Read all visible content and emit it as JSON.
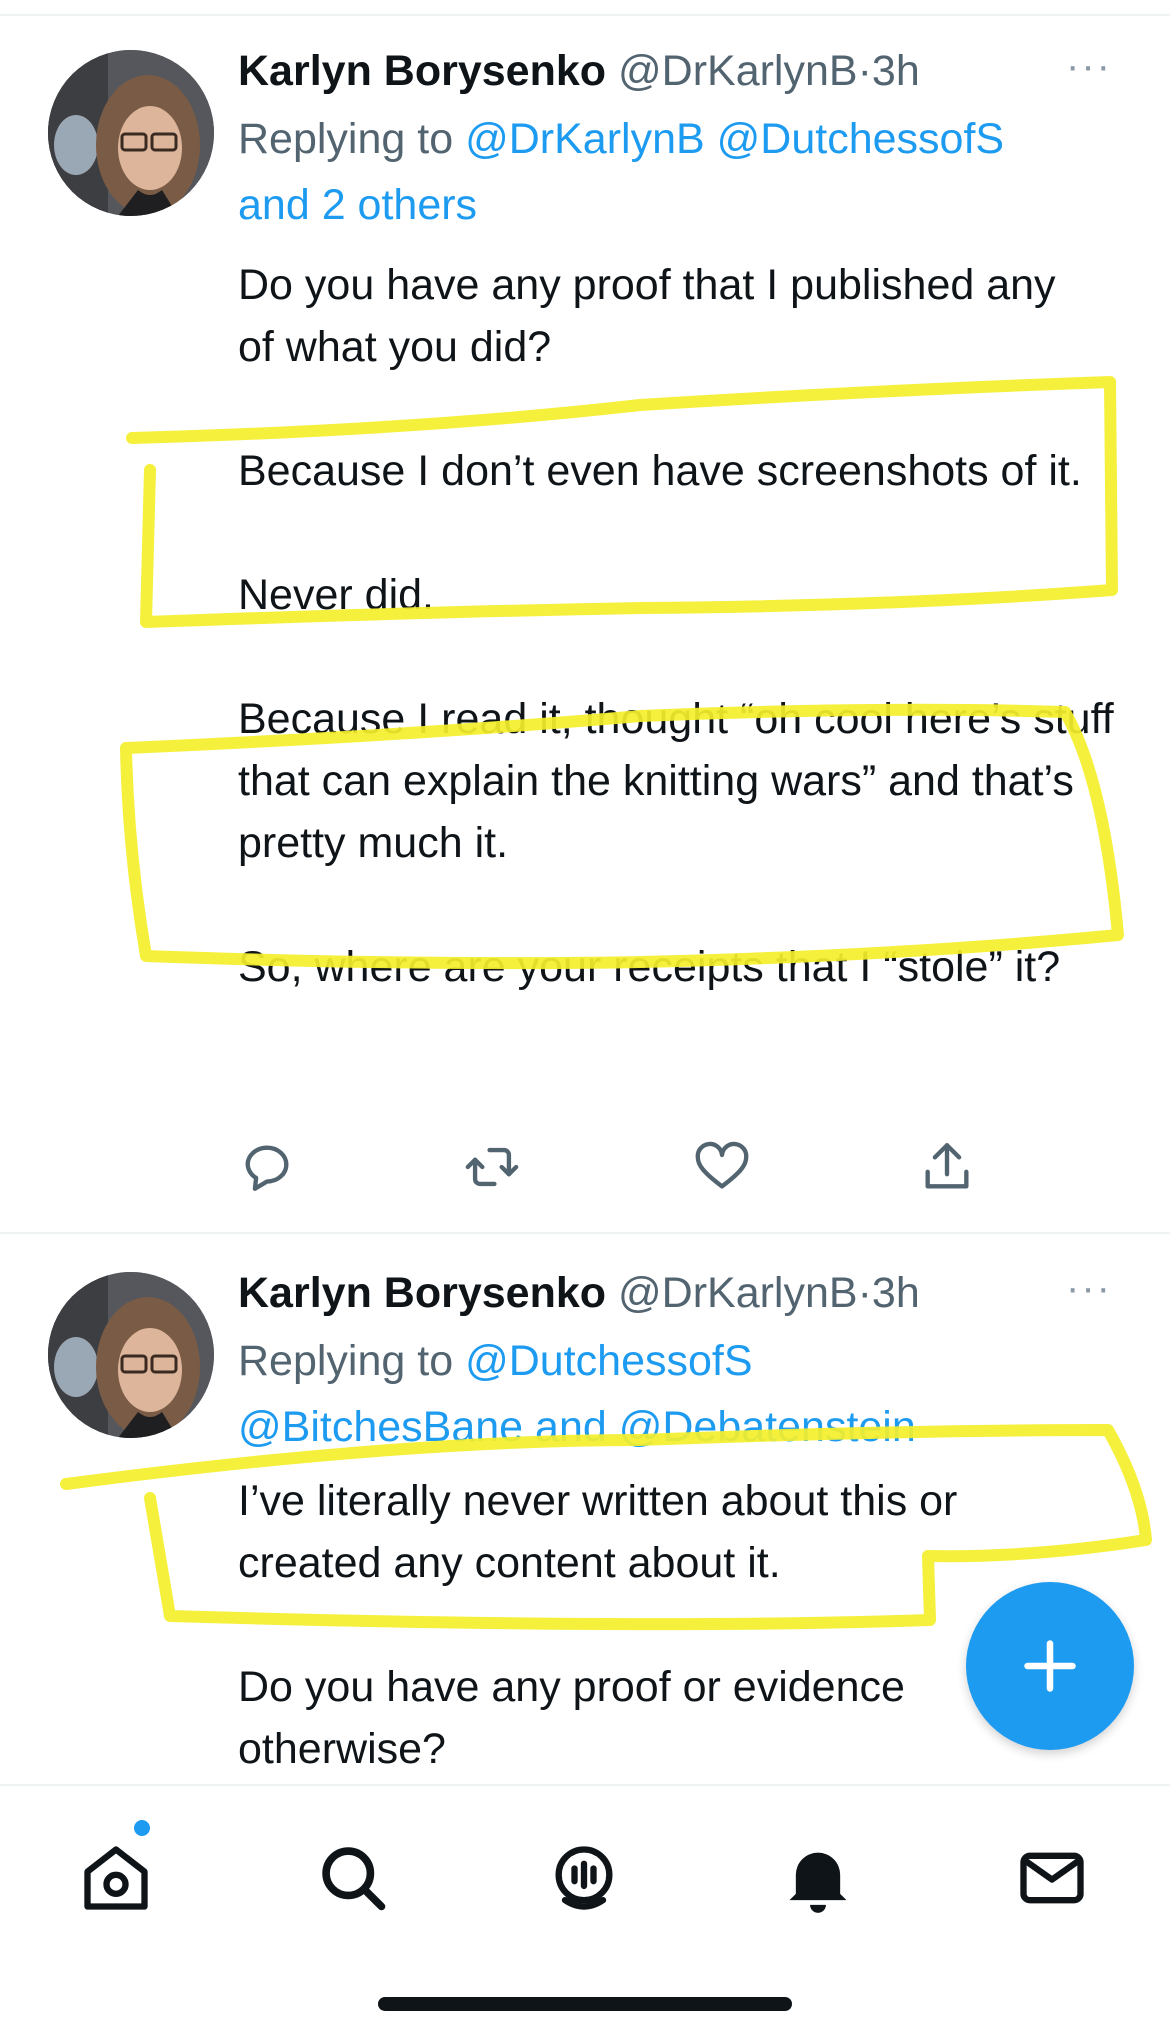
{
  "tweets": [
    {
      "name": "Karlyn Borysenko",
      "handle": "@DrKarlynB",
      "separator": "·",
      "time": "3h",
      "more": "···",
      "replying_prefix": "Replying to",
      "replying_to": [
        "@DrKarlynB",
        "@DutchessofS"
      ],
      "replying_extra": "and 2 others",
      "paragraphs": [
        "Do you have any proof that I published any of what you did?",
        "Because I don’t even have screenshots of it.",
        "Never did.",
        "Because I read it, thought “oh cool here’s stuff that can explain the knitting wars” and that’s pretty much it.",
        "So, where are your receipts that I “stole” it?"
      ],
      "actions": [
        "reply-icon",
        "retweet-icon",
        "like-icon",
        "share-icon"
      ]
    },
    {
      "name": "Karlyn Borysenko",
      "handle": "@DrKarlynB",
      "separator": "·",
      "time": "3h",
      "more": "···",
      "replying_prefix": "Replying to",
      "replying_to": [
        "@DutchessofS"
      ],
      "replying_line2": "@BitchesBane and @Debatenstein",
      "paragraphs": [
        "I’ve literally never written about this or created any content about it.",
        "Do you have any proof or evidence otherwise?"
      ]
    }
  ],
  "fab": {
    "icon": "compose-plus-icon",
    "label": "+"
  },
  "tabbar": {
    "items": [
      "home-icon",
      "search-icon",
      "spaces-icon",
      "notifications-icon",
      "messages-icon"
    ],
    "home_has_dot": true
  },
  "colors": {
    "accent": "#1d9bf0",
    "text": "#0f1419",
    "secondary": "#536471",
    "highlight": "#f4ef2a"
  }
}
